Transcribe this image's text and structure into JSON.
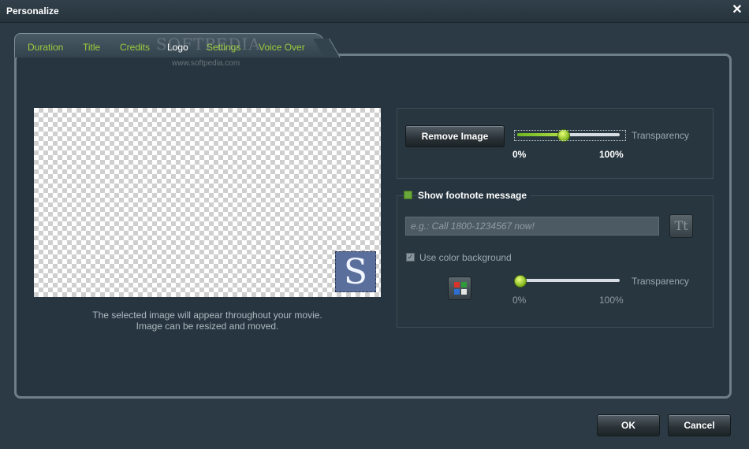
{
  "window": {
    "title": "Personalize"
  },
  "tabs": [
    {
      "label": "Duration"
    },
    {
      "label": "Title"
    },
    {
      "label": "Credits"
    },
    {
      "label": "Logo"
    },
    {
      "label": "Settings"
    },
    {
      "label": "Voice Over"
    }
  ],
  "watermark": {
    "text": "SOFTPEDIA",
    "url": "www.softpedia.com"
  },
  "preview": {
    "logo_letter": "S",
    "note_line1": "The selected image will appear throughout your movie.",
    "note_line2": "Image can be resized and moved."
  },
  "image_panel": {
    "remove_label": "Remove Image",
    "transparency_label": "Transparency",
    "transparency_value": 0.45,
    "min_label": "0%",
    "max_label": "100%"
  },
  "footnote": {
    "checkbox_label": "Show footnote message",
    "checked": true,
    "input_value": "",
    "input_placeholder": "e.g.: Call 1800-1234567 now!",
    "font_button_glyph": "Tt",
    "color_bg_label": "Use color background",
    "color_bg_checked": true,
    "transparency_label": "Transparency",
    "transparency_value": 0.0,
    "min_label": "0%",
    "max_label": "100%"
  },
  "footer": {
    "ok_label": "OK",
    "cancel_label": "Cancel"
  },
  "colors": {
    "tab_text": "#9ccc3c",
    "slider_accent": "#8cc63f",
    "checkbox_green": "#6aa83a",
    "background": "#2b3a44"
  },
  "icons": {
    "close": "close-icon",
    "font": "text-format-icon",
    "color_picker": "color-palette-icon"
  }
}
